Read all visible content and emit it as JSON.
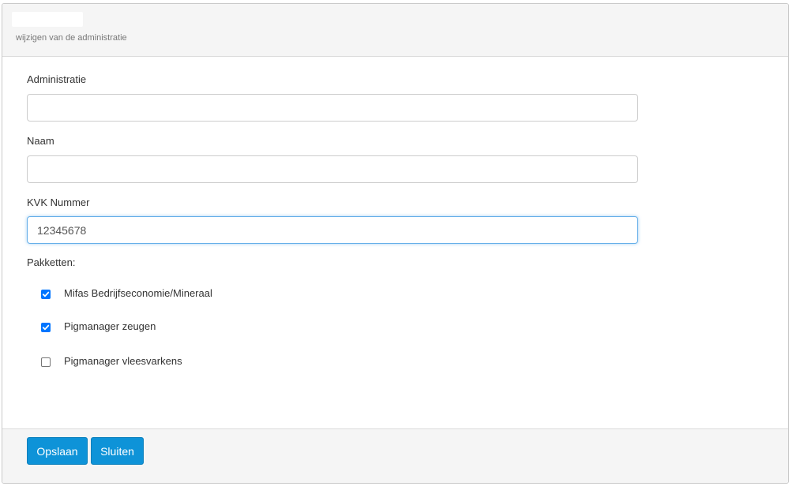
{
  "header": {
    "title": "",
    "subtitle": "wijzigen van de administratie"
  },
  "form": {
    "administratie": {
      "label": "Administratie",
      "value": ""
    },
    "naam": {
      "label": "Naam",
      "value": ""
    },
    "kvk": {
      "label": "KVK Nummer",
      "value": "12345678"
    },
    "pakketten": {
      "label": "Pakketten:",
      "items": [
        {
          "label": "Mifas Bedrijfseconomie/Mineraal",
          "checked": true
        },
        {
          "label": "Pigmanager zeugen",
          "checked": true
        },
        {
          "label": "Pigmanager vleesvarkens",
          "checked": false
        }
      ]
    }
  },
  "footer": {
    "save_label": "Opslaan",
    "close_label": "Sluiten"
  },
  "colors": {
    "primary_button": "#0e93d8",
    "checkbox_checked": "#0075ff",
    "focus_border": "#66afe9"
  }
}
